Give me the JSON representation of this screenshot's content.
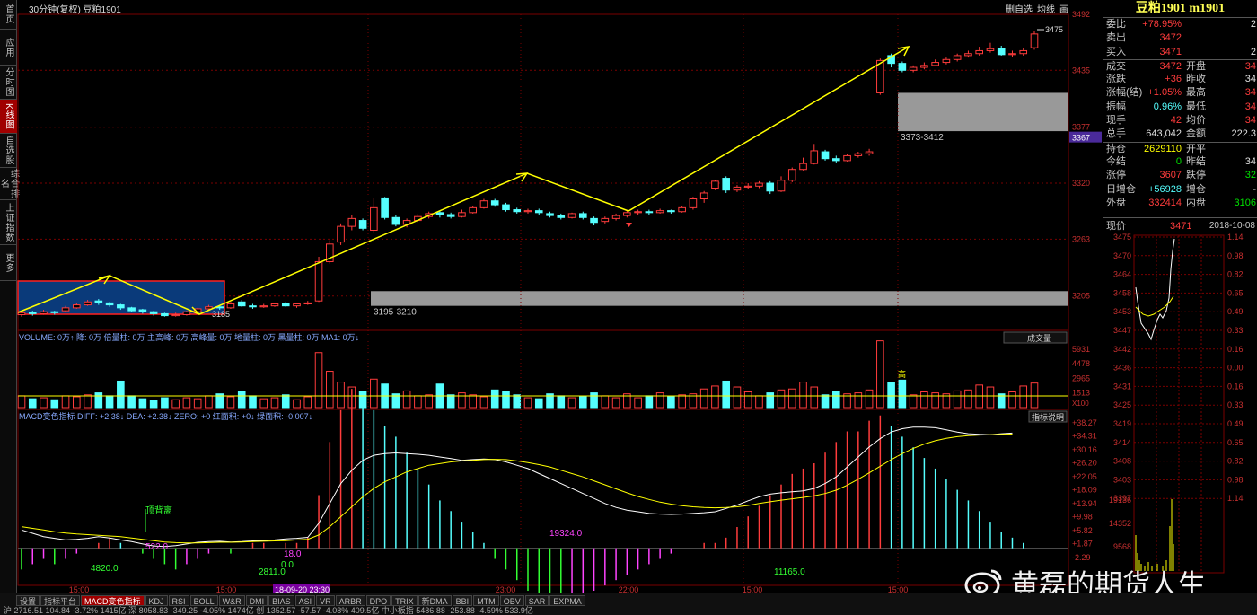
{
  "nav_tabs": [
    "首页",
    "应用",
    "分时图",
    "K线图",
    "自选股",
    "综合排名",
    "上证指数",
    "更多"
  ],
  "top": {
    "left": "30分钟(复权) 豆粕1901",
    "right": [
      "删自选",
      "均线",
      "画"
    ]
  },
  "contract_title": "豆粕1901 m1901",
  "quote": [
    {
      "l": "委比",
      "v": "+78.95%",
      "vc": "red",
      "l2": "",
      "v2": "2",
      "v2c": "white"
    },
    {
      "l": "卖出",
      "v": "3472",
      "vc": "red",
      "l2": "",
      "v2": "",
      "v2c": "white"
    },
    {
      "l": "买入",
      "v": "3471",
      "vc": "red",
      "l2": "",
      "v2": "2",
      "v2c": "white"
    },
    {
      "l": "成交",
      "v": "3472",
      "vc": "red",
      "l2": "开盘",
      "v2": "34",
      "v2c": "red"
    },
    {
      "l": "涨跌",
      "v": "+36",
      "vc": "red",
      "l2": "昨收",
      "v2": "34",
      "v2c": "white"
    },
    {
      "l": "涨幅(结)",
      "v": "+1.05%",
      "vc": "red",
      "l2": "最高",
      "v2": "34",
      "v2c": "red"
    },
    {
      "l": "振幅",
      "v": "0.96%",
      "vc": "cyan",
      "l2": "最低",
      "v2": "34",
      "v2c": "red"
    },
    {
      "l": "现手",
      "v": "42",
      "vc": "red",
      "l2": "均价",
      "v2": "34",
      "v2c": "red"
    },
    {
      "l": "总手",
      "v": "643,042",
      "vc": "white",
      "l2": "金额",
      "v2": "222.3",
      "v2c": "white"
    },
    {
      "l": "持仓",
      "v": "2629110",
      "vc": "yellow",
      "l2": "开平",
      "v2": "",
      "v2c": "white"
    },
    {
      "l": "今结",
      "v": "0",
      "vc": "green",
      "l2": "昨结",
      "v2": "34",
      "v2c": "white"
    },
    {
      "l": "涨停",
      "v": "3607",
      "vc": "red",
      "l2": "跌停",
      "v2": "32",
      "v2c": "green"
    },
    {
      "l": "日增仓",
      "v": "+56928",
      "vc": "cyan",
      "l2": "增仓",
      "v2": "-",
      "v2c": "white"
    },
    {
      "l": "外盘",
      "v": "332414",
      "vc": "red",
      "l2": "内盘",
      "v2": "3106",
      "v2c": "green"
    }
  ],
  "mini": {
    "label": "现价",
    "price": "3471",
    "date": "2018-10-08",
    "left_ticks": [
      "3475",
      "3470",
      "3464",
      "3458",
      "3453",
      "3447",
      "3442",
      "3436",
      "3431",
      "3425",
      "3419",
      "3414",
      "3408",
      "3403",
      "3397"
    ],
    "right_ticks": [
      "1.14",
      "0.98",
      "0.82",
      "0.65",
      "0.49",
      "0.33",
      "0.16",
      "0.00",
      "0.16",
      "0.33",
      "0.49",
      "0.65",
      "0.82",
      "0.98",
      "1.14"
    ],
    "vol_ticks": [
      "19136",
      "14352",
      "9568"
    ]
  },
  "price_axis": [
    "3492",
    "3435",
    "3377",
    "3367",
    "3320",
    "3263",
    "3205"
  ],
  "current_price_tag": "3367",
  "annot": {
    "last": "3475",
    "low": "3185",
    "gap1": "3195-3210",
    "gap2": "3373-3412"
  },
  "volume": {
    "legend": "VOLUME: 0万↑ 降: 0万 倍量柱: 0万 主高峰: 0万 高峰量: 0万 地量柱: 0万 黑量柱: 0万 MA1: 0万↓",
    "dropdown": "成交量",
    "axis": [
      "5931",
      "4478",
      "2965",
      "1513",
      "X100"
    ],
    "high": "高"
  },
  "macd": {
    "legend": "MACD变色指标  DIFF: +2.38↓  DEA: +2.38↓  ZERO: +0  红面积: +0↓  绿面积: -0.007↓",
    "btn": "指标说明",
    "axis": [
      "+38.27",
      "+34.31",
      "+30.16",
      "+26.20",
      "+22.05",
      "+18.09",
      "+13.94",
      "+9.98",
      "+5.82",
      "+1.87",
      "-2.29"
    ],
    "labels": [
      "顶背离",
      "4820.0",
      "522.0",
      "2811.0",
      "0.0",
      "18.0",
      "19324.0",
      "11165.0"
    ]
  },
  "time_axis": [
    "15:00",
    "15:00",
    "23:00",
    "22:00",
    "15:00",
    "15:00"
  ],
  "time_highlight": "18-09-20 23:30",
  "bottom_tabs": [
    "设置",
    "指标平台",
    "MACD变色指标",
    "KDJ",
    "RSI",
    "BOLL",
    "W&R",
    "DMI",
    "BIAS",
    "ASI",
    "VR",
    "ARBR",
    "DPO",
    "TRIX",
    "新DMA",
    "BBI",
    "MTM",
    "OBV",
    "SAR",
    "EXPMA"
  ],
  "ticker": "沪 2716.51   104.84   -3.72%   1415亿   深 8058.83   -349.25   -4.05%   1474亿   创 1352.57   -57.57   -4.08%   409.5亿   中小板指 5486.88   -253.88   -4.59%   533.9亿",
  "watermark": "黄磊的期货人生",
  "colors": {
    "up": "#ff3c3c",
    "down": "#55ffff",
    "grid": "#7a0000",
    "trend": "#ffff00"
  }
}
